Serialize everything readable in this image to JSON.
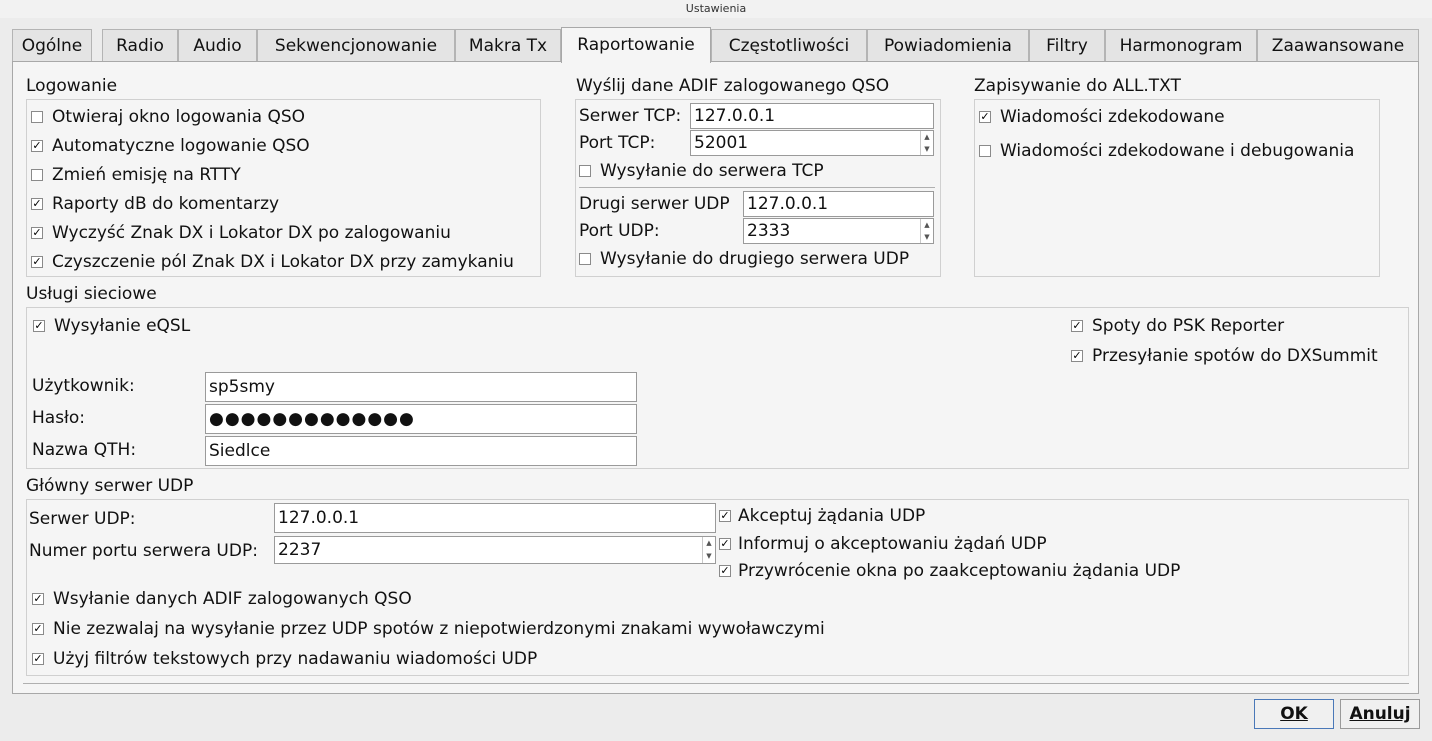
{
  "window": {
    "title": "Ustawienia"
  },
  "tabs": [
    {
      "label": "Ogólne"
    },
    {
      "label": "Radio"
    },
    {
      "label": "Audio"
    },
    {
      "label": "Sekwencjonowanie"
    },
    {
      "label": "Makra Tx"
    },
    {
      "label": "Raportowanie",
      "active": true
    },
    {
      "label": "Częstotliwości"
    },
    {
      "label": "Powiadomienia"
    },
    {
      "label": "Filtry"
    },
    {
      "label": "Harmonogram"
    },
    {
      "label": "Zaawansowane"
    }
  ],
  "logging": {
    "title": "Logowanie",
    "options": [
      {
        "label": "Otwieraj okno logowania QSO",
        "checked": false
      },
      {
        "label": "Automatyczne logowanie QSO",
        "checked": true
      },
      {
        "label": "Zmień emisję na RTTY",
        "checked": false
      },
      {
        "label": "Raporty dB do komentarzy",
        "checked": true
      },
      {
        "label": "Wyczyść Znak DX i Lokator DX po zalogowaniu",
        "checked": true
      },
      {
        "label": "Czyszczenie pól Znak DX i Lokator DX przy zamykaniu",
        "checked": true
      }
    ]
  },
  "adif": {
    "title": "Wyślij dane ADIF zalogowanego QSO",
    "tcp_server_label": "Serwer TCP:",
    "tcp_server_value": "127.0.0.1",
    "tcp_port_label": "Port TCP:",
    "tcp_port_value": "52001",
    "tcp_send": {
      "label": "Wysyłanie do serwera TCP",
      "checked": false
    },
    "udp2_server_label": "Drugi serwer UDP",
    "udp2_server_value": "127.0.0.1",
    "udp2_port_label": "Port UDP:",
    "udp2_port_value": "2333",
    "udp2_send": {
      "label": "Wysyłanie do drugiego serwera UDP",
      "checked": false
    }
  },
  "alltxt": {
    "title": "Zapisywanie do ALL.TXT",
    "options": [
      {
        "label": "Wiadomości zdekodowane",
        "checked": true
      },
      {
        "label": "Wiadomości zdekodowane i debugowania",
        "checked": false
      }
    ]
  },
  "network": {
    "title": "Usługi sieciowe",
    "eqsl": {
      "label": "Wysyłanie eQSL",
      "checked": true
    },
    "psk": {
      "label": "Spoty do PSK Reporter",
      "checked": true
    },
    "dxsummit": {
      "label": "Przesyłanie spotów do DXSummit",
      "checked": true
    },
    "user_label": "Użytkownik:",
    "user_value": "sp5smy",
    "password_label": "Hasło:",
    "password_value": "●●●●●●●●●●●●●",
    "qth_label": "Nazwa QTH:",
    "qth_value": "Siedlce"
  },
  "udp": {
    "title": "Główny serwer UDP",
    "server_label": "Serwer UDP:",
    "server_value": "127.0.0.1",
    "port_label": "Numer portu serwera UDP:",
    "port_value": "2237",
    "accept": {
      "label": "Akceptuj żądania UDP",
      "checked": true
    },
    "notify": {
      "label": "Informuj o akceptowaniu żądań UDP",
      "checked": true
    },
    "restore": {
      "label": "Przywrócenie okna po zaakceptowaniu żądania UDP",
      "checked": true
    },
    "send_adif": {
      "label": "Wsyłanie danych ADIF zalogowanych QSO",
      "checked": true
    },
    "no_unconfirmed": {
      "label": "Nie zezwalaj na wysyłanie przez UDP spotów z niepotwierdzonymi znakami wywoławczymi",
      "checked": true
    },
    "text_filters": {
      "label": "Użyj filtrów tekstowych przy nadawaniu wiadomości UDP",
      "checked": true
    }
  },
  "buttons": {
    "ok": "OK",
    "cancel": "Anuluj"
  }
}
